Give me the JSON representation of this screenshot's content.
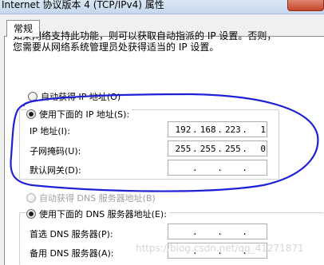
{
  "window": {
    "title": "Internet 协议版本 4 (TCP/IPv4) 属性"
  },
  "tabs": [
    {
      "label": "常规"
    }
  ],
  "description": {
    "line1": "如果网络支持此功能，则可以获取自动指派的 IP 设置。否则，",
    "line2": "您需要从网络系统管理员处获得适当的 IP 设置。"
  },
  "ip_section": {
    "auto_label": "自动获得 IP 地址(O)",
    "manual_label": "使用下面的 IP 地址(S):",
    "selected": "manual",
    "fields": [
      {
        "label": "IP 地址(I):",
        "octets": [
          "192",
          "168",
          "223",
          "1"
        ]
      },
      {
        "label": "子网掩码(U):",
        "octets": [
          "255",
          "255",
          "255",
          "0"
        ]
      },
      {
        "label": "默认网关(D):",
        "octets": [
          "",
          "",
          "",
          ""
        ]
      }
    ]
  },
  "dns_section": {
    "auto_label": "自动获得 DNS 服务器地址(B)",
    "auto_disabled": true,
    "manual_label": "使用下面的 DNS 服务器地址(E):",
    "selected": "manual",
    "fields": [
      {
        "label": "首选 DNS 服务器(P):",
        "octets": [
          "",
          "",
          "",
          ""
        ]
      },
      {
        "label": "备用 DNS 服务器(A):",
        "octets": [
          "",
          "",
          "",
          ""
        ]
      }
    ]
  },
  "watermark": "https://blog.csdn.net/qq_41271871",
  "colors": {
    "annotation_stroke": "#1f1fd6",
    "panel_border": "#8c8c8c",
    "disabled_text": "#a0a0a0"
  }
}
